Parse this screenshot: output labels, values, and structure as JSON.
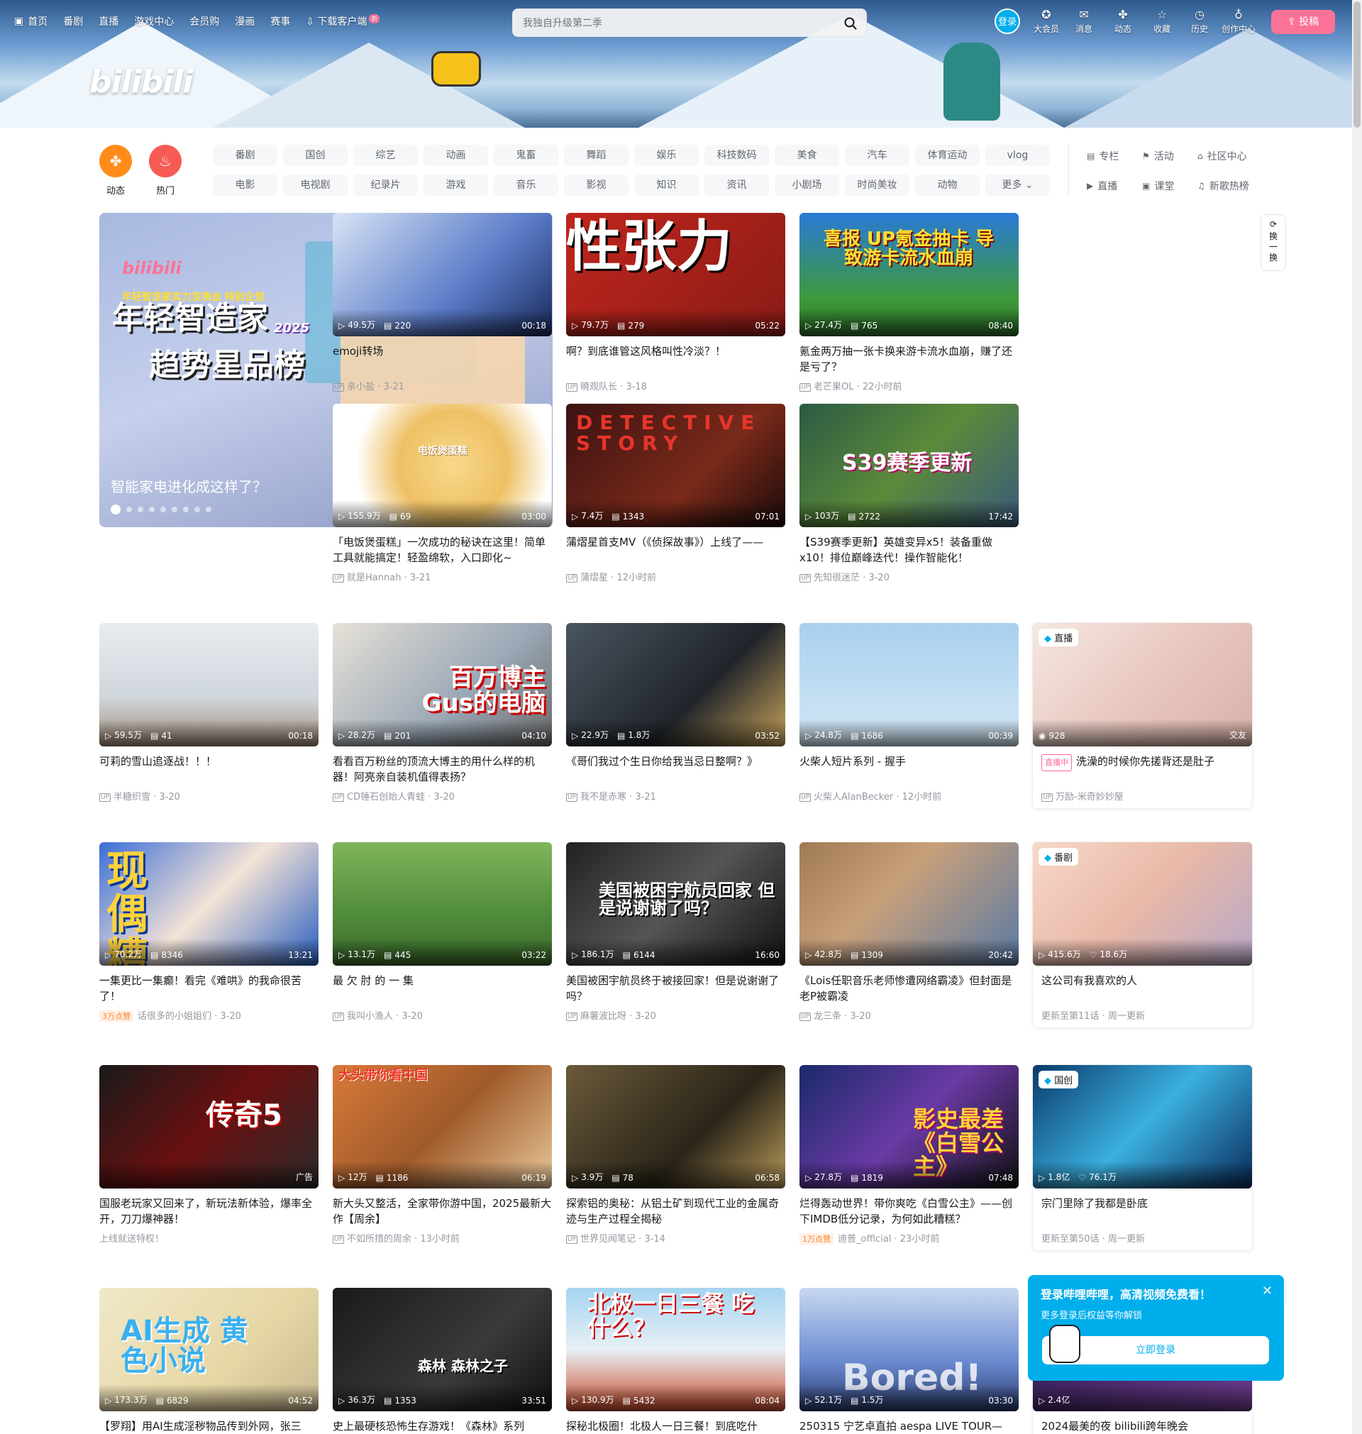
{
  "header": {
    "nav": [
      "首页",
      "番剧",
      "直播",
      "游戏中心",
      "会员购",
      "漫画",
      "赛事",
      "下载客户端"
    ],
    "new_badge": "新",
    "search_placeholder": "我独自升级第二季",
    "login": "登录",
    "right_nav": [
      "大会员",
      "消息",
      "动态",
      "收藏",
      "历史",
      "创作中心"
    ],
    "upload": "投稿",
    "logo": "bilibili"
  },
  "channels": {
    "main": [
      "动态",
      "热门"
    ],
    "row1": [
      "番剧",
      "国创",
      "综艺",
      "动画",
      "鬼畜",
      "舞蹈",
      "娱乐",
      "科技数码",
      "美食",
      "汽车",
      "体育运动",
      "vlog"
    ],
    "row2": [
      "电影",
      "电视剧",
      "纪录片",
      "游戏",
      "音乐",
      "影视",
      "知识",
      "资讯",
      "小剧场",
      "时尚美妆",
      "动物",
      "更多"
    ],
    "side": [
      "专栏",
      "活动",
      "社区中心",
      "直播",
      "课堂",
      "新歌热榜"
    ]
  },
  "carousel": {
    "logo": "bilibili",
    "subtitle": "年轻智造家实力发表会 特别企划",
    "big_line1": "年轻智造家",
    "year": "2025",
    "big_line2": "趋势星品榜",
    "caption": "智能家电进化成这样了？",
    "dot_count": 9
  },
  "refresh": "换一换",
  "cards": [
    {
      "views": "49.5万",
      "danmaku": "220",
      "dur": "00:18",
      "title": "emoji转场",
      "author": "亲小盐",
      "date": "3-21"
    },
    {
      "views": "79.7万",
      "danmaku": "279",
      "dur": "05:22",
      "title": "啊？到底谁管这风格叫性冷淡？！",
      "author": "曉观队长",
      "date": "3-18",
      "cap": "性张力"
    },
    {
      "views": "27.4万",
      "danmaku": "765",
      "dur": "08:40",
      "title": "氪金两万抽一张卡换来游卡流水血崩，赚了还是亏了？",
      "author": "老芒果OL",
      "date": "22小时前",
      "cap": "喜报 UP氪金抽卡 导致游卡流水血崩"
    },
    {
      "views": "155.9万",
      "danmaku": "69",
      "dur": "03:00",
      "title": "「电饭煲蛋糕」一次成功的秘诀在这里！简单工具就能搞定！轻盈绵软，入口即化~",
      "author": "就是Hannah",
      "date": "3-21",
      "cap": "电饭煲蛋糕"
    },
    {
      "views": "7.4万",
      "danmaku": "1343",
      "dur": "07:01",
      "title": "蒲熠星首支MV（《侦探故事》）上线了——",
      "author": "蒲熠星",
      "date": "12小时前",
      "cap": "DETECTIVE STORY"
    },
    {
      "views": "103万",
      "danmaku": "2722",
      "dur": "17:42",
      "title": "【S39赛季更新】英雄变异x5！装备重做x10！排位巅峰迭代！操作智能化！",
      "author": "先知很迷茫",
      "date": "3-20",
      "cap": "S39赛季更新"
    },
    {
      "views": "59.5万",
      "danmaku": "41",
      "dur": "00:18",
      "title": "可莉的雪山追逐战！！！",
      "author": "半糖织雪",
      "date": "3-20"
    },
    {
      "views": "28.2万",
      "danmaku": "201",
      "dur": "04:10",
      "title": "看看百万粉丝的顶流大博主的用什么样的机器！阿亮亲自装机值得表扬？",
      "author": "CD锤石创始人青蛙",
      "date": "3-20",
      "cap": "百万博主 Gus的电脑"
    },
    {
      "views": "22.9万",
      "danmaku": "1.8万",
      "dur": "03:52",
      "title": "《哥们我过个生日你给我当忌日整啊？》",
      "author": "我不是赤寒",
      "date": "3-21"
    },
    {
      "views": "24.8万",
      "danmaku": "1686",
      "dur": "00:39",
      "title": "火柴人短片系列 - 握手",
      "author": "火柴人AlanBecker",
      "date": "12小时前"
    },
    {
      "views": "70.2万",
      "danmaku": "8346",
      "dur": "13:21",
      "title": "一集更比一集癫！看完《难哄》的我命很苦了！",
      "author": "话很多的小姐姐们",
      "date": "3-20",
      "hot": "3万点赞",
      "cap": "现偶 糟粕"
    },
    {
      "views": "13.1万",
      "danmaku": "445",
      "dur": "03:22",
      "title": "最 欠 肘 的 一 集",
      "author": "我叫小渔人",
      "date": "3-20"
    },
    {
      "views": "186.1万",
      "danmaku": "6144",
      "dur": "16:60",
      "title": "美国被困宇航员终于被接回家！但是说谢谢了吗？",
      "author": "麻薯波比呀",
      "date": "3-20",
      "cap": "美国被困宇航员回家 但是说谢谢了吗？"
    },
    {
      "views": "42.8万",
      "danmaku": "1309",
      "dur": "20:42",
      "title": "《Lois任职音乐老师惨遭网络霸凌》但封面是老P被霸凌",
      "author": "龙三条",
      "date": "3-20"
    },
    {
      "views": "",
      "danmaku": "",
      "dur": "",
      "title": "国服老玩家又回来了，新玩法新体验，爆率全开，刀刀爆神器！",
      "author": "上线就送特权！",
      "date": "",
      "ad": "广告",
      "cap": "传奇5"
    },
    {
      "views": "12万",
      "danmaku": "1186",
      "dur": "06:19",
      "title": "新大头又整活，全家带你游中国，2025最新大作【周余】",
      "author": "不如所措的周余",
      "date": "13小时前",
      "cap": "大头带你看中国"
    },
    {
      "views": "3.9万",
      "danmaku": "78",
      "dur": "06:58",
      "title": "探索铝的奥秘：从铝土矿到现代工业的金属奇迹与生产过程全揭秘",
      "author": "世界见闻笔记",
      "date": "3-14"
    },
    {
      "views": "27.8万",
      "danmaku": "1819",
      "dur": "07:48",
      "title": "烂得轰动世界！带你爽吃《白雪公主》——创下IMDB低分记录，为何如此糟糕？",
      "author": "迪普_official",
      "date": "23小时前",
      "hot": "1万点赞",
      "cap": "影史最差 《白雪公主》"
    },
    {
      "views": "173.3万",
      "danmaku": "6829",
      "dur": "04:52",
      "title": "【罗翔】用AI生成淫秽物品传到外网，张三",
      "author": "",
      "date": "",
      "cap": "AI生成 黄色小说"
    },
    {
      "views": "36.3万",
      "danmaku": "1353",
      "dur": "33:51",
      "title": "史上最硬核恐怖生存游戏！《森林》系列",
      "author": "",
      "date": "",
      "cap": "森林 森林之子"
    },
    {
      "views": "130.9万",
      "danmaku": "5432",
      "dur": "08:04",
      "title": "探秘北极圈！北极人一日三餐！到底吃什",
      "author": "",
      "date": "",
      "cap": "北极一日三餐 吃什么？"
    },
    {
      "views": "52.1万",
      "danmaku": "1.5万",
      "dur": "03:30",
      "title": "250315 宁艺卓直拍 aespa LIVE TOUR—",
      "author": "",
      "date": "",
      "cap": "Bored!"
    }
  ],
  "features": [
    {
      "tag": "直播",
      "views": "928",
      "right": "交友",
      "live": "直播中",
      "title": "洗澡的时候你先搓背还是肚子",
      "author": "万励-米奇妙妙屋"
    },
    {
      "tag": "番剧",
      "views": "415.6万",
      "likes": "18.6万",
      "title": "这公司有我喜欢的人",
      "update": "更新至第11话 · 周一更新"
    },
    {
      "tag": "国创",
      "views": "1.8亿",
      "likes": "76.1万",
      "title": "宗门里除了我都是卧底",
      "update": "更新至第50话 · 周一更新"
    },
    {
      "views": "2.4亿",
      "title": "2024最美的夜 bilibili跨年晚会"
    }
  ],
  "popup": {
    "title": "登录哔哩哔哩，高清视频免费看！",
    "sub": "更多登录后权益等你解锁",
    "button": "立即登录"
  }
}
